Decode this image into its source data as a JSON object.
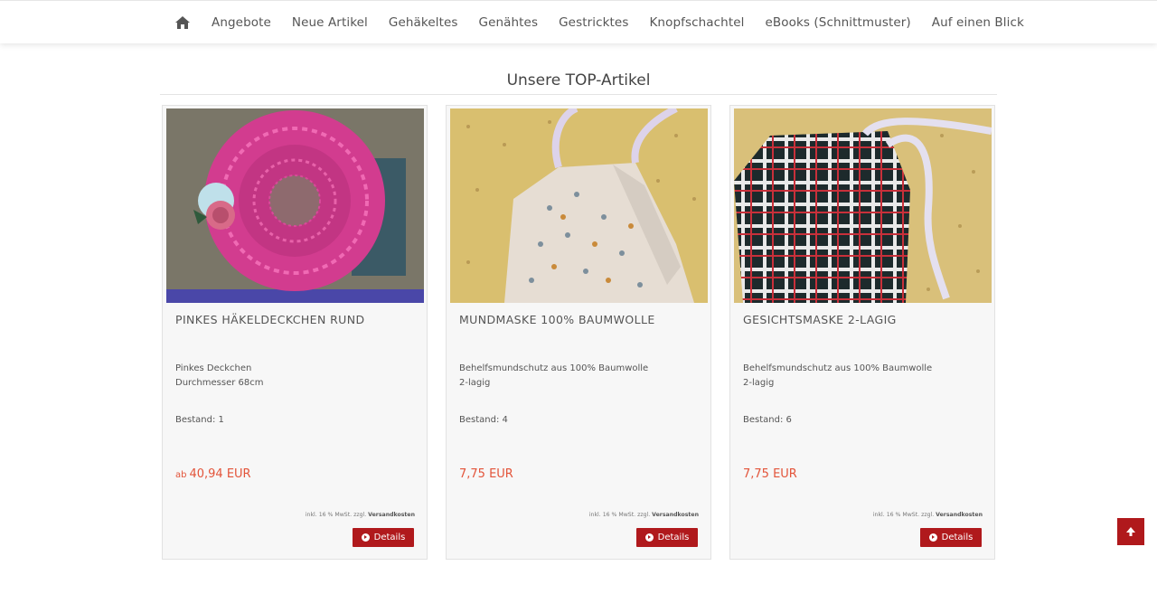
{
  "nav": {
    "home_icon": "home-icon",
    "items": [
      "Angebote",
      "Neue Artikel",
      "Gehäkeltes",
      "Genähtes",
      "Gestricktes",
      "Knopfschachtel",
      "eBooks (Schnittmuster)",
      "Auf einen Blick"
    ]
  },
  "section": {
    "title": "Unsere TOP-Artikel"
  },
  "products": [
    {
      "name": "PINKES HÄKELDECKCHEN RUND",
      "desc_line1": "Pinkes Deckchen",
      "desc_line2": "Durchmesser 68cm",
      "stock": "Bestand: 1",
      "price_prefix": "ab",
      "price": "40,94 EUR",
      "tax_text": "inkl. 16 % MwSt. zzgl.",
      "shipping_link": "Versandkosten",
      "button": "Details"
    },
    {
      "name": "MUNDMASKE 100% BAUMWOLLE",
      "desc_line1": "Behelfsmundschutz aus 100% Baumwolle",
      "desc_line2": "2-lagig",
      "stock": "Bestand: 4",
      "price_prefix": "",
      "price": "7,75 EUR",
      "tax_text": "inkl. 16 % MwSt. zzgl.",
      "shipping_link": "Versandkosten",
      "button": "Details"
    },
    {
      "name": "GESICHTSMASKE 2-LAGIG",
      "desc_line1": "Behelfsmundschutz aus 100% Baumwolle",
      "desc_line2": "2-lagig",
      "stock": "Bestand: 6",
      "price_prefix": "",
      "price": "7,75 EUR",
      "tax_text": "inkl. 16 % MwSt. zzgl.",
      "shipping_link": "Versandkosten",
      "button": "Details"
    }
  ],
  "colors": {
    "accent": "#b0191c",
    "price": "#e3543a"
  },
  "scroll_top_icon": "arrow-up-icon"
}
